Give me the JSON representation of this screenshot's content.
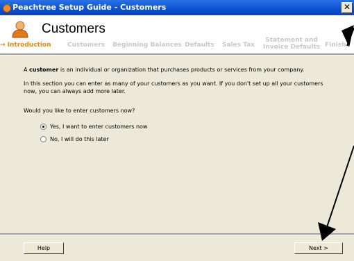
{
  "window": {
    "title": "Peachtree Setup Guide - Customers",
    "close_label": "✕"
  },
  "header": {
    "title": "Customers"
  },
  "steps": [
    {
      "label": "→ Introduction",
      "active": true
    },
    {
      "label": "Customers",
      "active": false
    },
    {
      "label": "Beginning Balances",
      "active": false
    },
    {
      "label": "Defaults",
      "active": false
    },
    {
      "label": "Sales Tax",
      "active": false
    },
    {
      "label_line1": "Statement and",
      "label_line2": "Invoice Defaults",
      "active": false
    },
    {
      "label": "Finish",
      "active": false
    }
  ],
  "content": {
    "para1_bold": "customer",
    "para1_prefix": "A",
    "para1_rest": "is an individual or organization that purchases products or services from your company.",
    "para2": "In this section you can enter as many of your customers as you want. If you don't set up all your customers now, you can always add more later.",
    "question": "Would you like to enter customers now?",
    "options": [
      {
        "label": "Yes, I want to enter customers now",
        "selected": true
      },
      {
        "label": "No, I will do this later",
        "selected": false
      }
    ]
  },
  "footer": {
    "help_label": "Help",
    "next_label": "Next >"
  },
  "colors": {
    "titlebar": "#0b4fcf",
    "active_step": "#e08a1e",
    "inactive_step": "#c8c8c8",
    "panel": "#ece9d8",
    "annotation_arrow": "#000000"
  }
}
